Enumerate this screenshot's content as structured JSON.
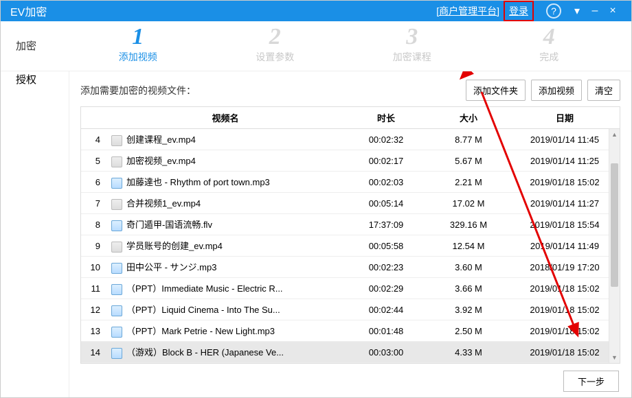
{
  "titlebar": {
    "title": "EV加密",
    "merchant_link": "[商户管理平台]",
    "login": "登录"
  },
  "steps": [
    {
      "num": "1",
      "label": "添加视频"
    },
    {
      "num": "2",
      "label": "设置参数"
    },
    {
      "num": "3",
      "label": "加密课程"
    },
    {
      "num": "4",
      "label": "完成"
    }
  ],
  "sidebar": {
    "encrypt": "加密",
    "authorize": "授权"
  },
  "toolbar": {
    "prompt": "添加需要加密的视频文件：",
    "add_folder": "添加文件夹",
    "add_video": "添加视频",
    "clear": "清空"
  },
  "columns": {
    "name": "视频名",
    "duration": "时长",
    "size": "大小",
    "date": "日期"
  },
  "rows": [
    {
      "idx": "4",
      "icon": "vid",
      "name": "创建课程_ev.mp4",
      "dur": "00:02:32",
      "size": "8.77 M",
      "date": "2019/01/14 11:45"
    },
    {
      "idx": "5",
      "icon": "vid",
      "name": "加密视频_ev.mp4",
      "dur": "00:02:17",
      "size": "5.67 M",
      "date": "2019/01/14 11:25"
    },
    {
      "idx": "6",
      "icon": "aud",
      "name": "加藤達也 - Rhythm of port town.mp3",
      "dur": "00:02:03",
      "size": "2.21 M",
      "date": "2019/01/18 15:02"
    },
    {
      "idx": "7",
      "icon": "vid",
      "name": "合并视频1_ev.mp4",
      "dur": "00:05:14",
      "size": "17.02 M",
      "date": "2019/01/14 11:27"
    },
    {
      "idx": "8",
      "icon": "aud",
      "name": "奇门遁甲-国语流畅.flv",
      "dur": "17:37:09",
      "size": "329.16 M",
      "date": "2019/01/18 15:54"
    },
    {
      "idx": "9",
      "icon": "vid",
      "name": "学员账号的创建_ev.mp4",
      "dur": "00:05:58",
      "size": "12.54 M",
      "date": "2019/01/14 11:49"
    },
    {
      "idx": "10",
      "icon": "aud",
      "name": "田中公平 - サンジ.mp3",
      "dur": "00:02:23",
      "size": "3.60 M",
      "date": "2018/01/19 17:20"
    },
    {
      "idx": "11",
      "icon": "aud",
      "name": "（PPT）Immediate Music - Electric R...",
      "dur": "00:02:29",
      "size": "3.66 M",
      "date": "2019/01/18 15:02"
    },
    {
      "idx": "12",
      "icon": "aud",
      "name": "（PPT）Liquid Cinema - Into The Su...",
      "dur": "00:02:44",
      "size": "3.92 M",
      "date": "2019/01/18 15:02"
    },
    {
      "idx": "13",
      "icon": "aud",
      "name": "（PPT）Mark Petrie - New Light.mp3",
      "dur": "00:01:48",
      "size": "2.50 M",
      "date": "2019/01/18 15:02"
    },
    {
      "idx": "14",
      "icon": "aud",
      "name": "（游戏）Block B - HER (Japanese Ve...",
      "dur": "00:03:00",
      "size": "4.33 M",
      "date": "2019/01/18 15:02",
      "selected": true
    }
  ],
  "footer": {
    "next": "下一步"
  }
}
